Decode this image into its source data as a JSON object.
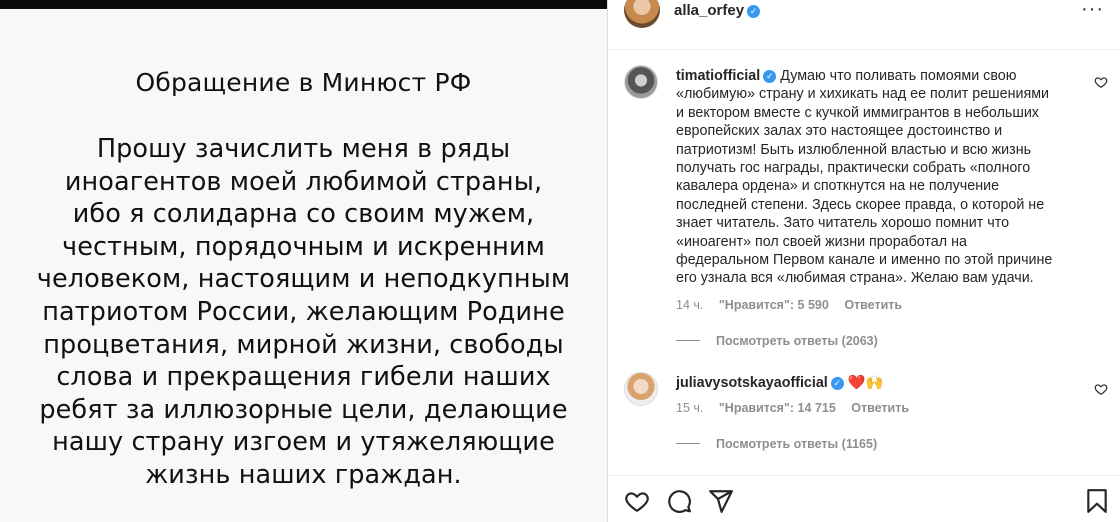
{
  "post_image": {
    "title": "Обращение в Минюст РФ",
    "body_lines": [
      "Прошу зачислить меня в ряды",
      "иноагентов моей любимой страны,",
      "ибо я солидарна со своим мужем,",
      "честным, порядочным и искренним",
      "человеком, настоящим и неподкупным",
      "патриотом России, желающим Родине",
      "процветания, мирной жизни, свободы",
      "слова и прекращения гибели наших",
      "ребят за иллюзорные цели, делающие",
      "нашу страну изгоем и утяжеляющие",
      "жизнь наших граждан."
    ]
  },
  "header": {
    "username": "alla_orfey",
    "more_icon": "more-dots-icon"
  },
  "comments": [
    {
      "username": "timatiofficial",
      "lines": [
        "Думаю что поливать помоями свою",
        "«любимую» страну и хихикать над ее полит решениями",
        "и вектором вместе с кучкой иммигрантов в небольших",
        "европейских залах это настоящее достоинство и",
        "патриотизм! Быть излюбленной властью и всю жизнь",
        "получать гос награды, практически собрать «полного",
        "кавалера ордена» и споткнутся на не получение",
        "последней степени. Здесь скорее правда, о которой не",
        "знает читатель. Зато читатель хорошо помнит что",
        "«иноагент» пол своей жизни проработал на",
        "федеральном Первом канале и именно по этой причине",
        "его узнала вся «любимая страна». Желаю вам удачи."
      ],
      "time": "14 ч.",
      "likes": "\"Нравится\": 5 590",
      "reply": "Ответить",
      "view_replies": "Посмотреть ответы (2063)"
    },
    {
      "username": "juliavysotskayaofficial",
      "text": "❤️🙌",
      "time": "15 ч.",
      "likes": "\"Нравится\": 14 715",
      "reply": "Ответить",
      "view_replies": "Посмотреть ответы (1165)"
    }
  ],
  "actions": {
    "icons": [
      "heart-icon",
      "comment-icon",
      "share-icon",
      "bookmark-icon"
    ]
  },
  "colors": {
    "verified": "#3897f0",
    "meta": "#8e8e8e",
    "text": "#262626"
  }
}
